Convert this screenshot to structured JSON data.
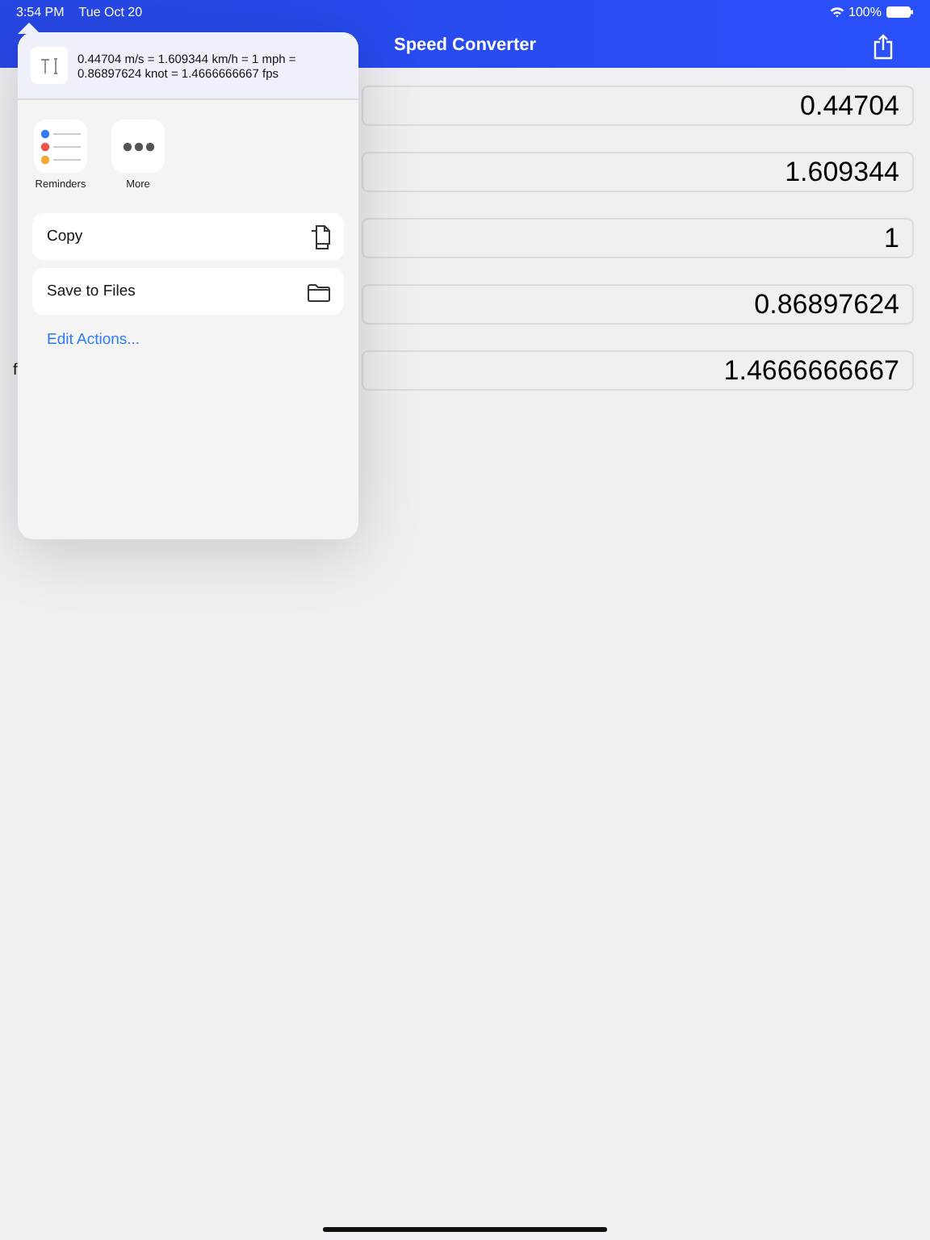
{
  "status_bar": {
    "time": "3:54 PM",
    "date": "Tue Oct 20",
    "battery": "100%"
  },
  "nav": {
    "title": "Speed Converter"
  },
  "rows": [
    {
      "value": "0.44704"
    },
    {
      "value": "1.609344"
    },
    {
      "value": "1"
    },
    {
      "value": "0.86897624"
    },
    {
      "label": "f",
      "value": "1.4666666667"
    }
  ],
  "share_sheet": {
    "preview": "0.44704 m/s = 1.609344 km/h = 1 mph = 0.86897624 knot =  1.4666666667 fps",
    "apps": [
      {
        "kind": "reminders",
        "label": "Reminders"
      },
      {
        "kind": "more",
        "label": "More"
      }
    ],
    "actions": [
      {
        "kind": "copy",
        "label": "Copy"
      },
      {
        "kind": "files",
        "label": "Save to Files"
      }
    ],
    "edit_link": "Edit Actions..."
  }
}
